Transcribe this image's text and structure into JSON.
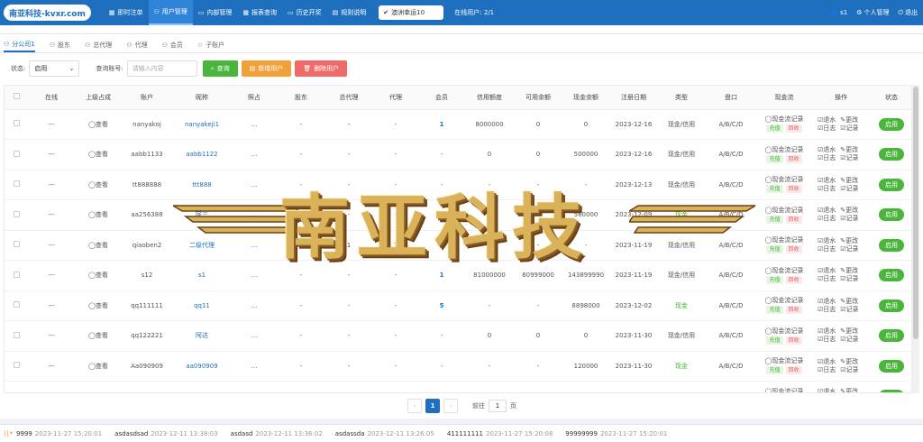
{
  "brand": "南亚科技-kvxr.com",
  "menu": [
    {
      "label": "即时注单",
      "icon": "grid-icon",
      "active": false
    },
    {
      "label": "用户管理",
      "icon": "user-icon",
      "active": true
    },
    {
      "label": "内部管理",
      "icon": "monitor-icon",
      "active": false
    },
    {
      "label": "报表查询",
      "icon": "calendar-icon",
      "active": false
    },
    {
      "label": "历史开奖",
      "icon": "screen-icon",
      "active": false
    },
    {
      "label": "规则说明",
      "icon": "book-icon",
      "active": false
    }
  ],
  "room_select": "澳洲幸运10",
  "online_users": "在线用户: 2/1",
  "top_right": {
    "user": "s1",
    "personal": "个人管理",
    "logout": "退出"
  },
  "tabs": [
    {
      "label": "分公司1",
      "active": true
    },
    {
      "label": "股东",
      "active": false
    },
    {
      "label": "总代理",
      "active": false
    },
    {
      "label": "代理",
      "active": false
    },
    {
      "label": "会员",
      "active": false
    },
    {
      "label": "子账户",
      "active": false
    }
  ],
  "filters": {
    "status_label": "状态:",
    "status_value": "启用",
    "query_label": "查询账号:",
    "query_placeholder": "请输入内容",
    "search_btn": "查询",
    "add_btn": "新增用户",
    "delete_btn": "删除用户"
  },
  "columns": [
    "",
    "在线",
    "上级占成",
    "账户",
    "昵称",
    "照占",
    "股东",
    "总代理",
    "代理",
    "会员",
    "信用额度",
    "可用余额",
    "现金余额",
    "注册日期",
    "类型",
    "盘口",
    "现金流",
    "操作",
    "状态"
  ],
  "rows": [
    {
      "online": "---",
      "view": "◯查看",
      "account": "nanyakoj",
      "nickname": "nanyakeji1",
      "ratio": "...",
      "shareholder": "-",
      "general": "-",
      "agent": "-",
      "member": "1",
      "credit": "8000000",
      "available": "0",
      "cash": "0",
      "date": "2023-12-16",
      "type": "现金/信用",
      "plate": "A/B/C/D",
      "status": "启用"
    },
    {
      "online": "---",
      "view": "◯查看",
      "account": "aabb1133",
      "nickname": "aabb1122",
      "ratio": "...",
      "shareholder": "-",
      "general": "-",
      "agent": "-",
      "member": "-",
      "credit": "0",
      "available": "0",
      "cash": "500000",
      "date": "2023-12-16",
      "type": "现金/信用",
      "plate": "A/B/C/D",
      "status": "启用"
    },
    {
      "online": "---",
      "view": "◯查看",
      "account": "tt888888",
      "nickname": "ttt888",
      "ratio": "...",
      "shareholder": "-",
      "general": "-",
      "agent": "-",
      "member": "-",
      "credit": "-",
      "available": "-",
      "cash": "-",
      "date": "2023-12-13",
      "type": "现金/信用",
      "plate": "A/B/C/D",
      "status": "启用"
    },
    {
      "online": "---",
      "view": "◯查看",
      "account": "aa256388",
      "nickname": "阿三",
      "ratio": "...",
      "shareholder": "-",
      "general": "-",
      "agent": "-",
      "member": "-",
      "credit": "-",
      "available": "-",
      "cash": "560000",
      "date": "2023-12-09",
      "type": "现金",
      "plate": "A/B/C/D",
      "status": "启用"
    },
    {
      "online": "---",
      "view": "◯查看",
      "account": "qiaoben2",
      "nickname": "二级代理",
      "ratio": "...",
      "shareholder": "1",
      "general": "1",
      "agent": "2",
      "member": "5",
      "credit": "-",
      "available": "-",
      "cash": "-",
      "date": "2023-11-19",
      "type": "现金/信用",
      "plate": "A/B/C/D",
      "status": "启用"
    },
    {
      "online": "---",
      "view": "◯查看",
      "account": "s12",
      "nickname": "s1",
      "ratio": "...",
      "shareholder": "-",
      "general": "-",
      "agent": "-",
      "member": "1",
      "credit": "81000000",
      "available": "80999000",
      "cash": "143899990",
      "date": "2023-11-19",
      "type": "现金/信用",
      "plate": "A/B/C/D",
      "status": "启用"
    },
    {
      "online": "---",
      "view": "◯查看",
      "account": "qq111111",
      "nickname": "qq11",
      "ratio": "...",
      "shareholder": "-",
      "general": "-",
      "agent": "-",
      "member": "5",
      "credit": "-",
      "available": "-",
      "cash": "8898000",
      "date": "2023-12-02",
      "type": "现金",
      "plate": "A/B/C/D",
      "status": "启用"
    },
    {
      "online": "---",
      "view": "◯查看",
      "account": "qq122221",
      "nickname": "阿达",
      "ratio": "...",
      "shareholder": "-",
      "general": "-",
      "agent": "-",
      "member": "-",
      "credit": "0",
      "available": "0",
      "cash": "0",
      "date": "2023-11-30",
      "type": "现金/信用",
      "plate": "A/B/C/D",
      "status": "启用"
    },
    {
      "online": "---",
      "view": "◯查看",
      "account": "Aa090909",
      "nickname": "aa090909",
      "ratio": "...",
      "shareholder": "-",
      "general": "-",
      "agent": "-",
      "member": "-",
      "credit": "-",
      "available": "-",
      "cash": "120000",
      "date": "2023-11-30",
      "type": "现金",
      "plate": "A/B/C/D",
      "status": "启用"
    },
    {
      "online": "",
      "view": "",
      "account": "",
      "nickname": "",
      "ratio": "",
      "shareholder": "",
      "general": "",
      "agent": "",
      "member": "",
      "credit": "",
      "available": "",
      "cash": "",
      "date": "",
      "type": "",
      "plate": "",
      "status": "启用"
    }
  ],
  "cashflow": {
    "record": "◯现金流记录",
    "charge": "充值",
    "withdraw": "回收"
  },
  "ops": {
    "refund": "☑退水",
    "log": "☑日志",
    "edit": "✎更改",
    "record": "☑记录"
  },
  "pager": {
    "current": "1",
    "prev": "‹",
    "next": "›",
    "goto_label": "前往",
    "goto_value": "1",
    "page_unit": "页"
  },
  "watermark": "南亚科技",
  "logs": [
    {
      "user": "9999",
      "time": "2023-11-27 15:20:01"
    },
    {
      "user": "asdasdsad",
      "time": "2023-12-11 13:38:03"
    },
    {
      "user": "asdasd",
      "time": "2023-12-11 13:36:02"
    },
    {
      "user": "asdassda",
      "time": "2023-12-11 13:26:05"
    },
    {
      "user": "411111111",
      "time": "2023-11-27 15:20:08"
    },
    {
      "user": "99999999",
      "time": "2023-11-27 15:20:01"
    }
  ]
}
